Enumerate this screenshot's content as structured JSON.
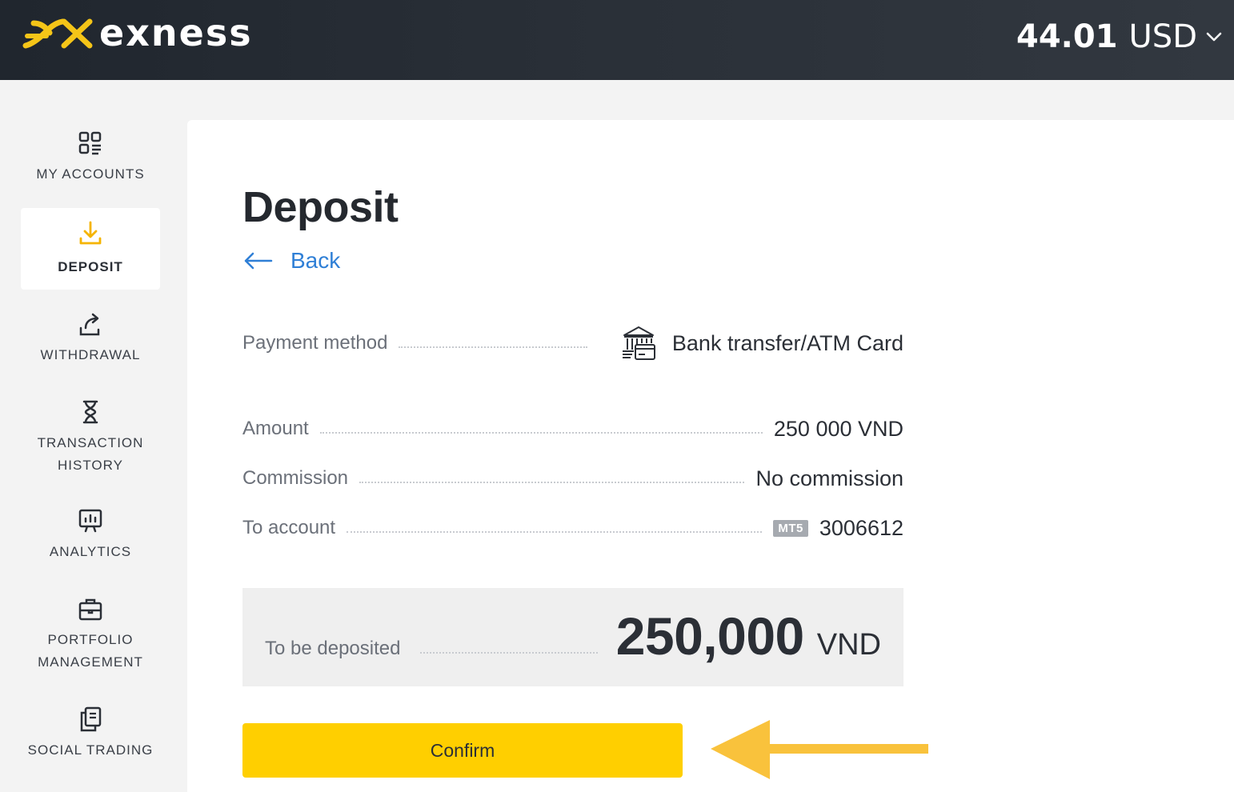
{
  "header": {
    "logo_text": "exness",
    "balance_amount": "44.01",
    "balance_currency": "USD"
  },
  "sidebar": {
    "items": [
      {
        "label": "MY ACCOUNTS",
        "icon": "accounts-grid-icon"
      },
      {
        "label": "DEPOSIT",
        "icon": "download-icon",
        "active": true
      },
      {
        "label": "WITHDRAWAL",
        "icon": "upload-share-icon"
      },
      {
        "label_line1": "TRANSACTION",
        "label_line2": "HISTORY",
        "icon": "hourglass-icon"
      },
      {
        "label": "ANALYTICS",
        "icon": "chart-board-icon"
      },
      {
        "label_line1": "PORTFOLIO",
        "label_line2": "MANAGEMENT",
        "icon": "briefcase-icon"
      },
      {
        "label": "SOCIAL TRADING",
        "icon": "copy-icon"
      }
    ]
  },
  "main": {
    "title": "Deposit",
    "back_label": "Back",
    "payment_method_label": "Payment method",
    "payment_method_value": "Bank transfer/ATM Card",
    "amount_label": "Amount",
    "amount_value": "250 000 VND",
    "commission_label": "Commission",
    "commission_value": "No commission",
    "to_account_label": "To account",
    "to_account_badge": "MT5",
    "to_account_value": "3006612",
    "to_be_deposited_label": "To be deposited",
    "to_be_deposited_amount": "250,000",
    "to_be_deposited_currency": "VND",
    "confirm_label": "Confirm"
  },
  "colors": {
    "brand_yellow": "#ffcf00",
    "link_blue": "#2f7fd6",
    "header_dark": "#262c34",
    "arrow_yellow": "#f9c23c"
  }
}
